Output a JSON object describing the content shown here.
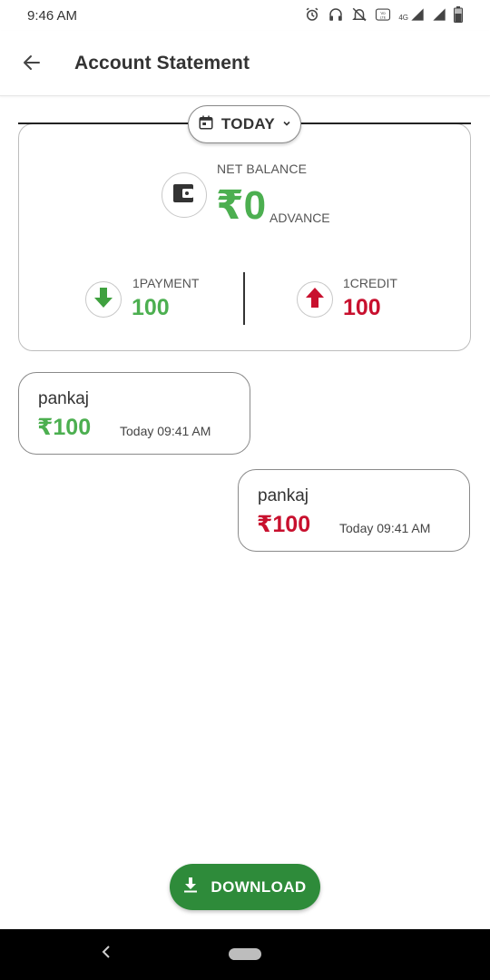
{
  "status_bar": {
    "time": "9:46 AM",
    "network_label": "4G",
    "volte_label": "VoLTE",
    "icons": [
      "alarm-icon",
      "headset-icon",
      "notifications-off-icon",
      "volte-icon",
      "signal-4g-icon",
      "signal-icon",
      "battery-icon"
    ]
  },
  "app_bar": {
    "title": "Account Statement",
    "back_icon": "arrow-back-icon"
  },
  "summary": {
    "date_filter": "TODAY",
    "net_balance_label": "NET BALANCE",
    "net_balance_value": "₹0",
    "net_balance_status": "ADVANCE",
    "payment_label": "1PAYMENT",
    "payment_value": "100",
    "credit_label": "1CREDIT",
    "credit_value": "100"
  },
  "transactions": [
    {
      "name": "pankaj",
      "amount": "₹100",
      "time": "Today 09:41 AM",
      "type": "payment",
      "color": "#4caf50"
    },
    {
      "name": "pankaj",
      "amount": "₹100",
      "time": "Today 09:41 AM",
      "type": "credit",
      "color": "#c8102e"
    }
  ],
  "download": {
    "label": "DOWNLOAD"
  },
  "colors": {
    "accent_green": "#4caf50",
    "button_green": "#2e8b3a",
    "credit_red": "#c8102e"
  }
}
